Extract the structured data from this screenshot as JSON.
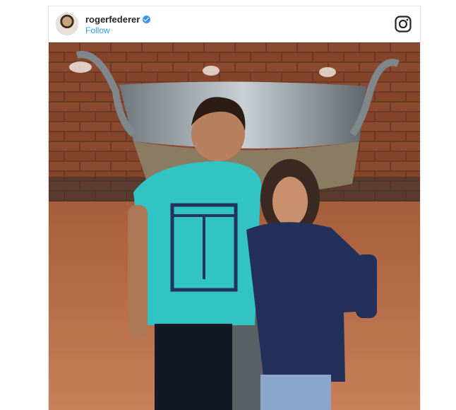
{
  "post": {
    "username": "rogerfederer",
    "follow_label": "Follow",
    "verified": true
  },
  "icons": {
    "brand": "instagram-icon",
    "badge": "verified-badge-icon"
  },
  "colors": {
    "accent": "#3897f0",
    "text": "#262626",
    "border": "#e6e6e6"
  },
  "image": {
    "brick_wall": "#7a3f28",
    "clay_court": "#b86a44",
    "trophy": "#9aa3a8",
    "shirt_left": "#2fc7c7",
    "shirt_right": "#1d2b4f"
  }
}
